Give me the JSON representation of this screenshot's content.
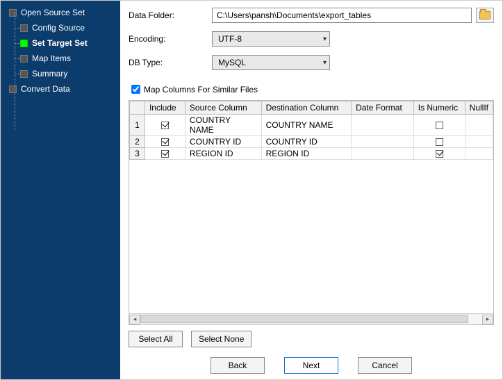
{
  "sidebar": {
    "items": [
      {
        "label": "Open Source Set",
        "level": 0,
        "active": false
      },
      {
        "label": "Config Source",
        "level": 1,
        "active": false
      },
      {
        "label": "Set Target Set",
        "level": 1,
        "active": true
      },
      {
        "label": "Map Items",
        "level": 1,
        "active": false
      },
      {
        "label": "Summary",
        "level": 1,
        "active": false
      },
      {
        "label": "Convert Data",
        "level": 0,
        "active": false
      }
    ]
  },
  "form": {
    "dataFolder_label": "Data Folder:",
    "dataFolder_value": "C:\\Users\\pansh\\Documents\\export_tables",
    "encoding_label": "Encoding:",
    "encoding_value": "UTF-8",
    "dbType_label": "DB Type:",
    "dbType_value": "MySQL",
    "mapColumns_label": "Map Columns For Similar Files",
    "mapColumns_checked": true
  },
  "grid": {
    "headers": {
      "rownum": "",
      "include": "Include",
      "source": "Source Column",
      "dest": "Destination Column",
      "datefmt": "Date Format",
      "isnum": "Is Numeric",
      "nullif": "NullIf"
    },
    "rows": [
      {
        "n": "1",
        "include": true,
        "source": "COUNTRY NAME",
        "dest": "COUNTRY NAME",
        "datefmt": "",
        "isnum": false,
        "nullif": ""
      },
      {
        "n": "2",
        "include": true,
        "source": "COUNTRY ID",
        "dest": "COUNTRY ID",
        "datefmt": "",
        "isnum": false,
        "nullif": ""
      },
      {
        "n": "3",
        "include": true,
        "source": "REGION ID",
        "dest": "REGION ID",
        "datefmt": "",
        "isnum": true,
        "nullif": ""
      }
    ]
  },
  "buttons": {
    "selectAll": "Select All",
    "selectNone": "Select None",
    "back": "Back",
    "next": "Next",
    "cancel": "Cancel"
  }
}
